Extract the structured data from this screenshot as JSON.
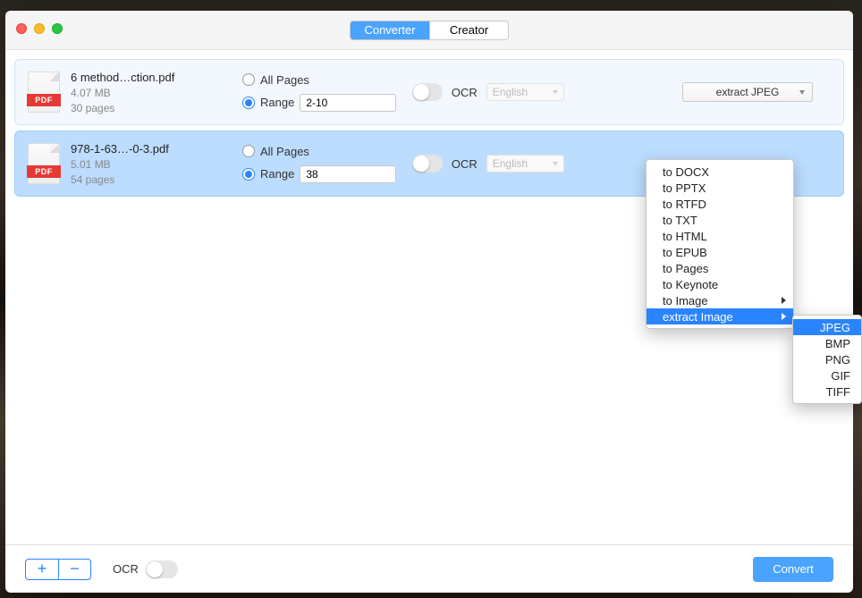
{
  "tabs": {
    "converter": "Converter",
    "creator": "Creator"
  },
  "files": [
    {
      "icon_label": "PDF",
      "name": "6 method…ction.pdf",
      "size": "4.07 MB",
      "pages": "30 pages",
      "all_pages": "All Pages",
      "range_label": "Range",
      "range_value": "2-10",
      "ocr": "OCR",
      "lang": "English",
      "format": "extract JPEG"
    },
    {
      "icon_label": "PDF",
      "name": "978-1-63…-0-3.pdf",
      "size": "5.01 MB",
      "pages": "54 pages",
      "all_pages": "All Pages",
      "range_label": "Range",
      "range_value": "38",
      "ocr": "OCR",
      "lang": "English"
    }
  ],
  "menu": {
    "items": [
      "to DOCX",
      "to PPTX",
      "to RTFD",
      "to TXT",
      "to HTML",
      "to EPUB",
      "to Pages",
      "to Keynote",
      "to Image",
      "extract Image"
    ],
    "sub_items": [
      "JPEG",
      "BMP",
      "PNG",
      "GIF",
      "TIFF"
    ]
  },
  "footer": {
    "plus": "+",
    "minus": "−",
    "ocr": "OCR",
    "convert": "Convert"
  }
}
